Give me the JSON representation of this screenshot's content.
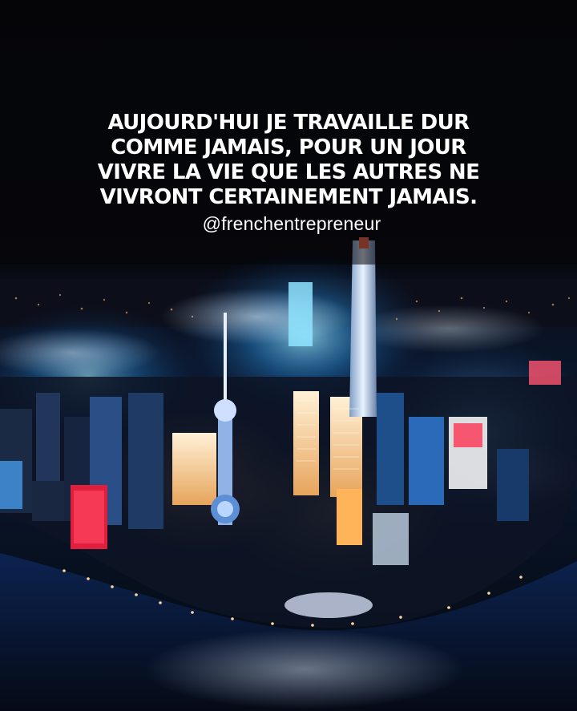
{
  "quote": {
    "lines": [
      "AUJOURD'HUI JE TRAVAILLE DUR",
      "COMME JAMAIS, POUR UN JOUR",
      "VIVRE LA VIE QUE LES AUTRES NE",
      "VIVRONT CERTAINEMENT JAMAIS."
    ],
    "handle": "@frenchentrepreneur"
  },
  "colors": {
    "sky": "#06070d",
    "glow_cyan": "#5fd8ff",
    "glow_blue": "#2f6bff",
    "light_warm": "#ffc27a",
    "light_red": "#ff2a4a",
    "water": "#07132a"
  },
  "photo": {
    "subject": "city-skyline-at-night"
  }
}
